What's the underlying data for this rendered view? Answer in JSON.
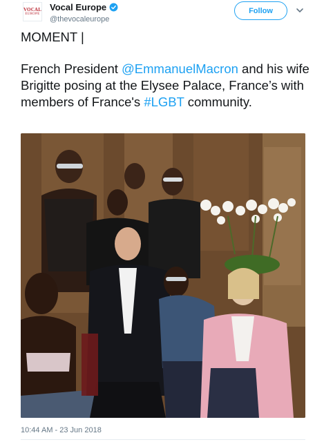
{
  "account": {
    "avatar_line1": "VOCAL",
    "avatar_line2": "EUROPE",
    "display_name": "Vocal Europe",
    "handle": "@thevocaleurope",
    "verified": true
  },
  "follow_button": {
    "label": "Follow"
  },
  "menu": {
    "icon": "chevron-down-icon"
  },
  "tweet": {
    "paragraph1": "MOMENT |",
    "text_prefix": "French President ",
    "mention": "@EmmanuelMacron",
    "text_middle": " and his wife Brigitte posing at the Elysee Palace, France’s with members of France's ",
    "hashtag": "#LGBT",
    "text_suffix": " community."
  },
  "timestamp": "10:44 AM - 23 Jun 2018",
  "colors": {
    "link": "#1da1f2",
    "text": "#14171a",
    "muted": "#657786",
    "brand_red": "#b8232f"
  }
}
